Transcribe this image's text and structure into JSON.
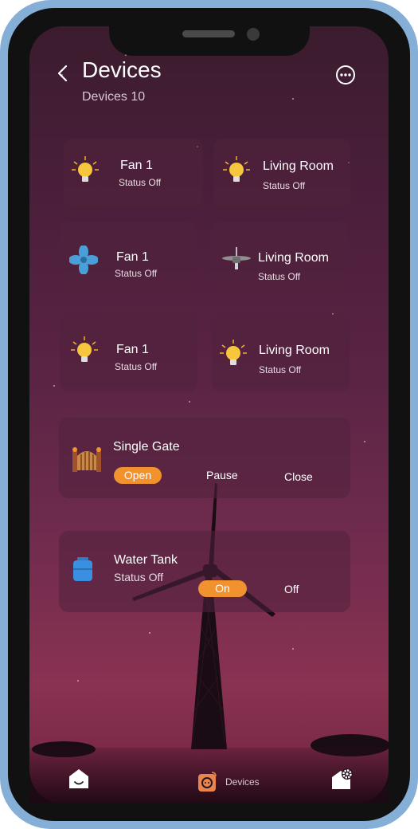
{
  "header": {
    "title": "Devices",
    "count_label": "Devices 10"
  },
  "cards": [
    {
      "name": "Fan 1",
      "status": "Status Off",
      "icon": "bulb-icon"
    },
    {
      "name": "Living Room",
      "status": "Status Off",
      "icon": "bulb-icon"
    },
    {
      "name": "Fan 1",
      "status": "Status Off",
      "icon": "fan-icon"
    },
    {
      "name": "Living Room",
      "status": "Status Off",
      "icon": "ceiling-fan-icon"
    },
    {
      "name": "Fan 1",
      "status": "Status Off",
      "icon": "bulb-icon"
    },
    {
      "name": "Living Room",
      "status": "Status Off",
      "icon": "bulb-icon"
    }
  ],
  "gate": {
    "name": "Single Gate",
    "open": "Open",
    "pause": "Pause",
    "close": "Close"
  },
  "tank": {
    "name": "Water Tank",
    "status": "Status Off",
    "on": "On",
    "off": "Off"
  },
  "nav": {
    "devices_label": "Devices"
  },
  "colors": {
    "accent": "#f2922e",
    "frame": "#86afd8"
  }
}
